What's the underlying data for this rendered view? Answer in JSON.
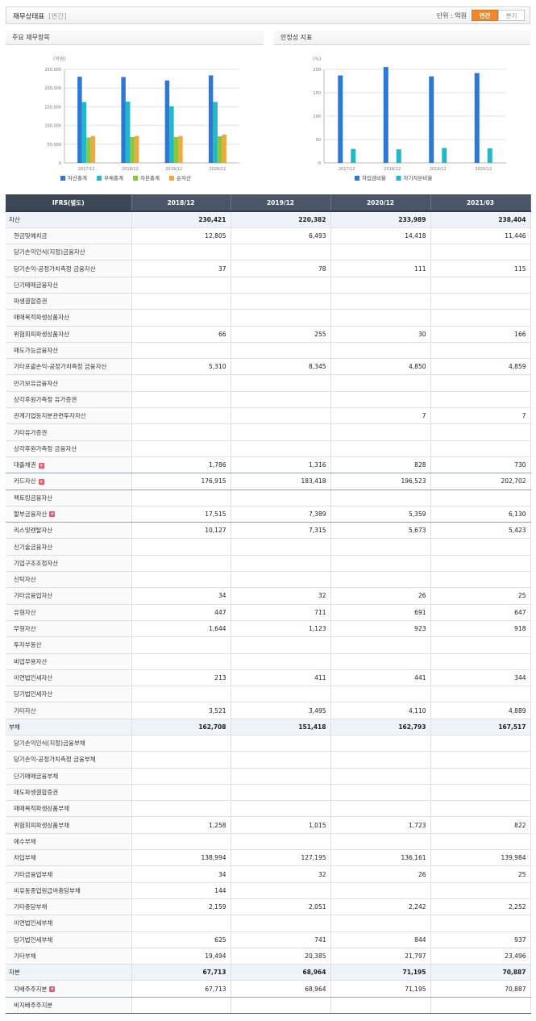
{
  "header": {
    "title": "재무상태표",
    "subtitle": "[연간]",
    "unit_label": "단위 : 억원",
    "toggle_annual": "연간",
    "toggle_quarter": "분기"
  },
  "panels": {
    "main_title": "주요 재무항목",
    "stability_title": "안정성 지표"
  },
  "colors": {
    "asset": "#2b78d6",
    "liability": "#22b8c8",
    "equity": "#8cc63f",
    "net": "#f2a93b",
    "accent": "#f0882a",
    "header_bg": "#4a5667"
  },
  "chart_data": [
    {
      "type": "bar",
      "unit_label": "(억원)",
      "categories": [
        "2017/12",
        "2018/12",
        "2019/12",
        "2020/12"
      ],
      "ylim": [
        0,
        250000
      ],
      "yticks": [
        0,
        50000,
        100000,
        150000,
        200000,
        250000
      ],
      "ytick_labels": [
        "0",
        "50,000",
        "100,000",
        "150,000",
        "200,000",
        "250,000"
      ],
      "grid": true,
      "legend": "bottom",
      "series": [
        {
          "name": "자산총계",
          "color": "#2b78d6",
          "values": [
            230421,
            229500,
            220382,
            233989
          ]
        },
        {
          "name": "부채총계",
          "color": "#22b8c8",
          "values": [
            162708,
            163500,
            151418,
            162793
          ]
        },
        {
          "name": "자본총계",
          "color": "#8cc63f",
          "values": [
            67713,
            68964,
            68964,
            71195
          ]
        },
        {
          "name": "순자산",
          "color": "#f2a93b",
          "values": [
            72000,
            72000,
            72000,
            76000
          ]
        }
      ]
    },
    {
      "type": "bar",
      "unit_label": "(%)",
      "categories": [
        "2017/12",
        "2018/12",
        "2019/12",
        "2020/12"
      ],
      "ylim": [
        0,
        200
      ],
      "yticks": [
        0,
        50,
        100,
        150,
        200
      ],
      "ytick_labels": [
        "0",
        "50",
        "100",
        "150",
        "200"
      ],
      "grid": true,
      "legend": "bottom",
      "series": [
        {
          "name": "차입금비율",
          "color": "#2b78d6",
          "values": [
            187,
            205,
            185,
            192
          ]
        },
        {
          "name": "자기자본비율",
          "color": "#22b8c8",
          "values": [
            30,
            29,
            32,
            31
          ]
        }
      ]
    }
  ],
  "table": {
    "corner": "IFRS(별도)",
    "columns": [
      "2018/12",
      "2019/12",
      "2020/12",
      "2021/03"
    ],
    "rows": [
      {
        "label": "자산",
        "values": [
          "230,421",
          "220,382",
          "233,989",
          "238,404"
        ],
        "major": true
      },
      {
        "label": "현금및예치금",
        "values": [
          "12,805",
          "6,493",
          "14,418",
          "11,446"
        ]
      },
      {
        "label": "당기손익인식(지정)금융자산",
        "values": [
          "",
          "",
          "",
          ""
        ]
      },
      {
        "label": "당기손익-공정가치측정 금융자산",
        "values": [
          "37",
          "78",
          "111",
          "115"
        ]
      },
      {
        "label": "단기매매금융자산",
        "values": [
          "",
          "",
          "",
          ""
        ]
      },
      {
        "label": "파생결합증권",
        "values": [
          "",
          "",
          "",
          ""
        ]
      },
      {
        "label": "매매목적파생상품자산",
        "values": [
          "",
          "",
          "",
          ""
        ]
      },
      {
        "label": "위험회피파생상품자산",
        "values": [
          "66",
          "255",
          "30",
          "166"
        ]
      },
      {
        "label": "매도가능금융자산",
        "values": [
          "",
          "",
          "",
          ""
        ]
      },
      {
        "label": "기타포괄손익-공정가치측정 금융자산",
        "values": [
          "5,310",
          "8,345",
          "4,850",
          "4,859"
        ]
      },
      {
        "label": "만기보유금융자산",
        "values": [
          "",
          "",
          "",
          ""
        ]
      },
      {
        "label": "상각후원가측정 유가증권",
        "values": [
          "",
          "",
          "",
          ""
        ]
      },
      {
        "label": "관계기업등지분관련투자자산",
        "values": [
          "",
          "",
          "7",
          "7"
        ]
      },
      {
        "label": "기타유가증권",
        "values": [
          "",
          "",
          "",
          ""
        ]
      },
      {
        "label": "상각후원가측정 금융자산",
        "values": [
          "",
          "",
          "",
          ""
        ]
      },
      {
        "label": "대출채권",
        "values": [
          "1,786",
          "1,316",
          "828",
          "730"
        ],
        "expand": true,
        "sep": true
      },
      {
        "label": "카드자산",
        "values": [
          "176,915",
          "183,418",
          "196,523",
          "202,702"
        ],
        "expand": true,
        "sep": true
      },
      {
        "label": "팩토링금융자산",
        "values": [
          "",
          "",
          "",
          ""
        ]
      },
      {
        "label": "할부금융자산",
        "values": [
          "17,515",
          "7,389",
          "5,359",
          "6,130"
        ],
        "expand": true,
        "sep": true
      },
      {
        "label": "리스및렌탈자산",
        "values": [
          "10,127",
          "7,315",
          "5,673",
          "5,423"
        ]
      },
      {
        "label": "신기술금융자산",
        "values": [
          "",
          "",
          "",
          ""
        ]
      },
      {
        "label": "기업구조조정자산",
        "values": [
          "",
          "",
          "",
          ""
        ]
      },
      {
        "label": "신탁자산",
        "values": [
          "",
          "",
          "",
          ""
        ]
      },
      {
        "label": "기타금융업자산",
        "values": [
          "34",
          "32",
          "26",
          "25"
        ]
      },
      {
        "label": "유형자산",
        "values": [
          "447",
          "711",
          "691",
          "647"
        ]
      },
      {
        "label": "무형자산",
        "values": [
          "1,644",
          "1,123",
          "923",
          "918"
        ]
      },
      {
        "label": "투자부동산",
        "values": [
          "",
          "",
          "",
          ""
        ]
      },
      {
        "label": "비업무용자산",
        "values": [
          "",
          "",
          "",
          ""
        ]
      },
      {
        "label": "이연법인세자산",
        "values": [
          "213",
          "411",
          "441",
          "344"
        ]
      },
      {
        "label": "당기법인세자산",
        "values": [
          "",
          "",
          "",
          ""
        ]
      },
      {
        "label": "기타자산",
        "values": [
          "3,521",
          "3,495",
          "4,110",
          "4,889"
        ]
      },
      {
        "label": "부채",
        "values": [
          "162,708",
          "151,418",
          "162,793",
          "167,517"
        ],
        "major": true
      },
      {
        "label": "당기손익인식(지정)금융부채",
        "values": [
          "",
          "",
          "",
          ""
        ]
      },
      {
        "label": "당기손익-공정가치측정 금융부채",
        "values": [
          "",
          "",
          "",
          ""
        ]
      },
      {
        "label": "단기매매금융부채",
        "values": [
          "",
          "",
          "",
          ""
        ]
      },
      {
        "label": "매도파생결합증권",
        "values": [
          "",
          "",
          "",
          ""
        ]
      },
      {
        "label": "매매목적파생상품부채",
        "values": [
          "",
          "",
          "",
          ""
        ]
      },
      {
        "label": "위험회피파생상품부채",
        "values": [
          "1,258",
          "1,015",
          "1,723",
          "822"
        ]
      },
      {
        "label": "예수부채",
        "values": [
          "",
          "",
          "",
          ""
        ]
      },
      {
        "label": "차입부채",
        "values": [
          "138,994",
          "127,195",
          "136,161",
          "139,984"
        ]
      },
      {
        "label": "기타금융업부채",
        "values": [
          "34",
          "32",
          "26",
          "25"
        ]
      },
      {
        "label": "비유동종업원급여충당부채",
        "values": [
          "144",
          "",
          "",
          ""
        ]
      },
      {
        "label": "기타충당부채",
        "values": [
          "2,159",
          "2,051",
          "2,242",
          "2,252"
        ]
      },
      {
        "label": "이연법인세부채",
        "values": [
          "",
          "",
          "",
          ""
        ]
      },
      {
        "label": "당기법인세부채",
        "values": [
          "625",
          "741",
          "844",
          "937"
        ]
      },
      {
        "label": "기타부채",
        "values": [
          "19,494",
          "20,385",
          "21,797",
          "23,496"
        ]
      },
      {
        "label": "자본",
        "values": [
          "67,713",
          "68,964",
          "71,195",
          "70,887"
        ],
        "major": true
      },
      {
        "label": "지배주주지분",
        "values": [
          "67,713",
          "68,964",
          "71,195",
          "70,887"
        ],
        "expand": true,
        "sep": true
      },
      {
        "label": "비지배주주지분",
        "values": [
          "",
          "",
          "",
          ""
        ]
      }
    ]
  }
}
